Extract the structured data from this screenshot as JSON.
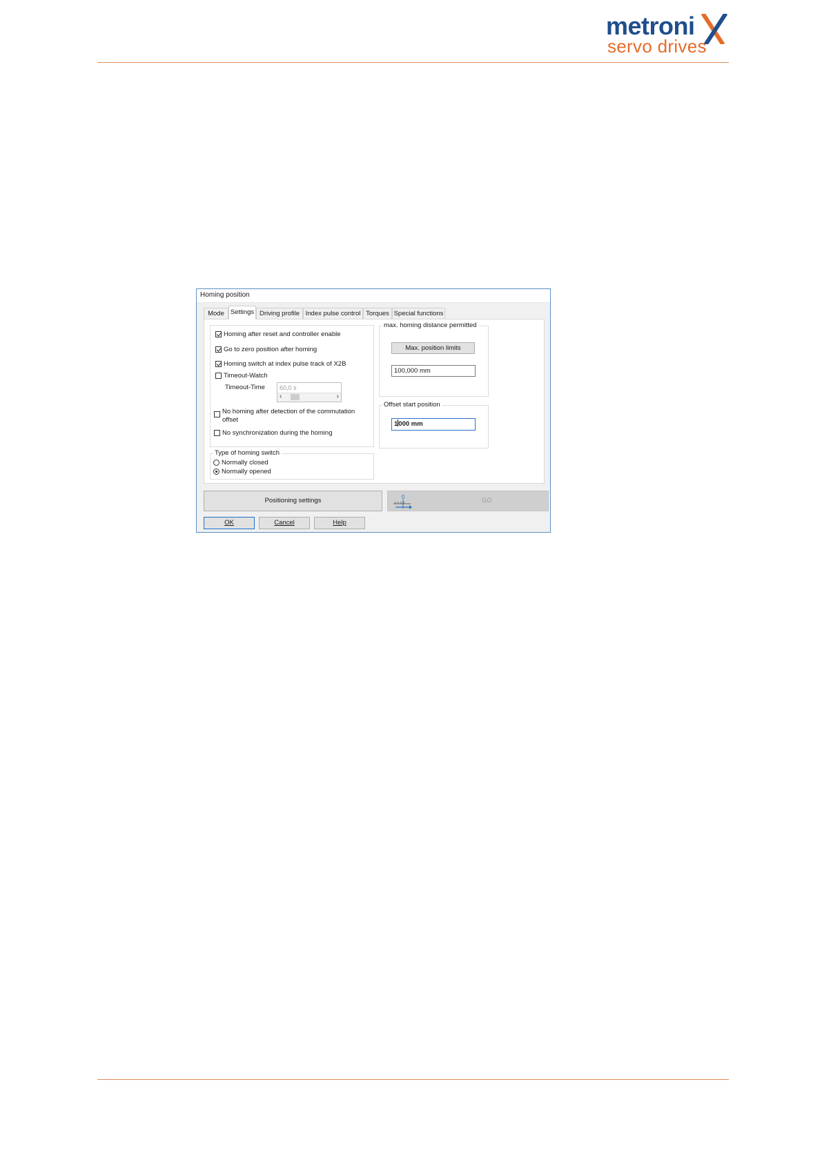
{
  "brand": {
    "name_top": "metroni",
    "name_bottom": "servo drives",
    "colors": {
      "blue": "#1f4e8c",
      "orange": "#e46c2a"
    }
  },
  "dialog": {
    "title": "Homing position",
    "tabs": [
      {
        "label": "Mode",
        "active": false
      },
      {
        "label": "Settings",
        "active": true
      },
      {
        "label": "Driving profile",
        "active": false
      },
      {
        "label": "Index pulse control",
        "active": false
      },
      {
        "label": "Torques",
        "active": false
      },
      {
        "label": "Special functions",
        "active": false
      }
    ],
    "options": {
      "homing_after_reset": {
        "label": "Homing after reset and controller enable",
        "checked": true
      },
      "go_to_zero": {
        "label": "Go to zero position after homing",
        "checked": true
      },
      "homing_switch_index": {
        "label": "Homing switch at index pulse track of X2B",
        "checked": true
      },
      "timeout_watch": {
        "label": "Timeout-Watch",
        "checked": false
      },
      "timeout_time": {
        "label": "Timeout-Time",
        "value": "60,0 s"
      },
      "no_homing_after_commutation": {
        "label_line1": "No homing after detection of the commutation",
        "label_line2": "offset",
        "checked": false
      },
      "no_sync": {
        "label": "No synchronization during the homing",
        "checked": false
      }
    },
    "homing_switch_type": {
      "title": "Type of homing switch",
      "options": [
        {
          "label": "Normally closed",
          "selected": false
        },
        {
          "label": "Normally opened",
          "selected": true
        }
      ]
    },
    "max_distance": {
      "title": "max. homing distance permitted",
      "button_label": "Max. position limits",
      "value": "100,000 mm"
    },
    "offset_start": {
      "title": "Offset start position",
      "value_before_caret": "1",
      "value_after_caret": "000 mm"
    },
    "positioning_settings_label": "Positioning settings",
    "go_label": "GO",
    "go_icon_label": "0",
    "buttons": {
      "ok": "OK",
      "cancel": "Cancel",
      "help": "Help"
    }
  }
}
